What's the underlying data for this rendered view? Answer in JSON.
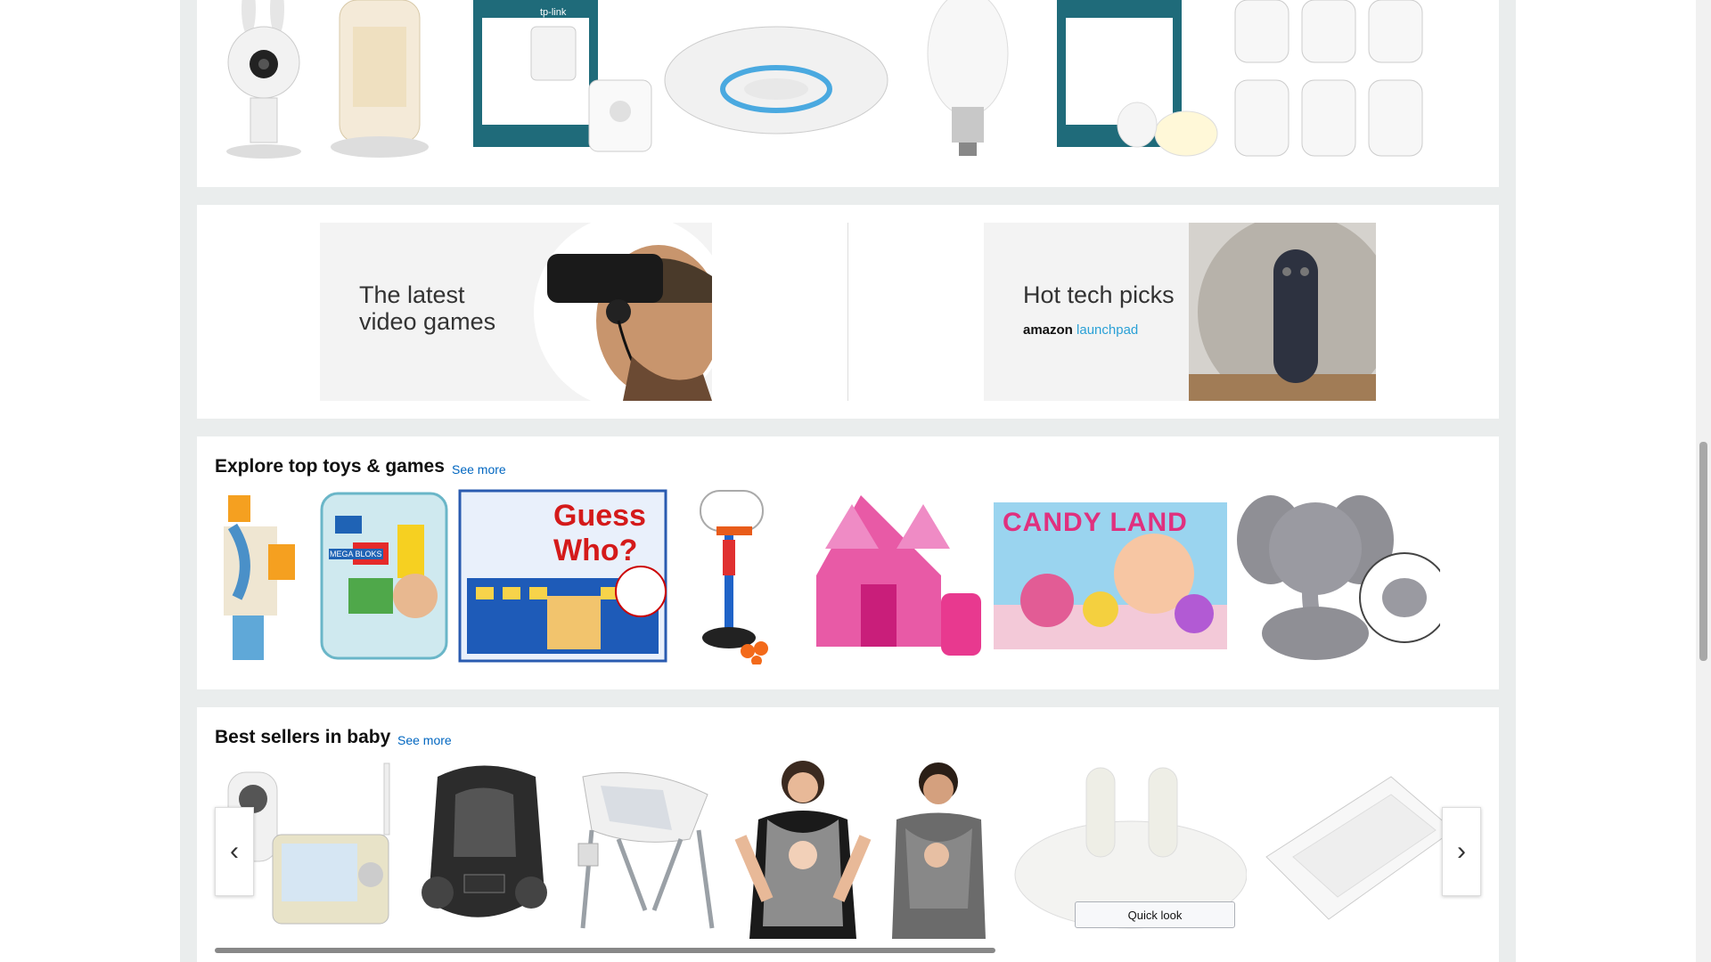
{
  "banners": {
    "left": {
      "line1": "The latest",
      "line2": "video games"
    },
    "right": {
      "title": "Hot tech picks",
      "brand_prefix": "amazon",
      "brand_suffix": "launchpad"
    }
  },
  "toys": {
    "title": "Explore top toys & games",
    "see_more": "See more"
  },
  "baby": {
    "title": "Best sellers in baby",
    "see_more": "See more",
    "quick_look": "Quick look",
    "prev_icon": "chevron-left-icon",
    "next_icon": "chevron-right-icon"
  },
  "products": {
    "tplink_brand": "tp-link",
    "guess_who": "Guess Who?",
    "candy_land": "CANDY LAND",
    "mega_bloks": "MEGA BLOKS"
  },
  "colors": {
    "link": "#0066c0",
    "background": "#eaeded"
  }
}
